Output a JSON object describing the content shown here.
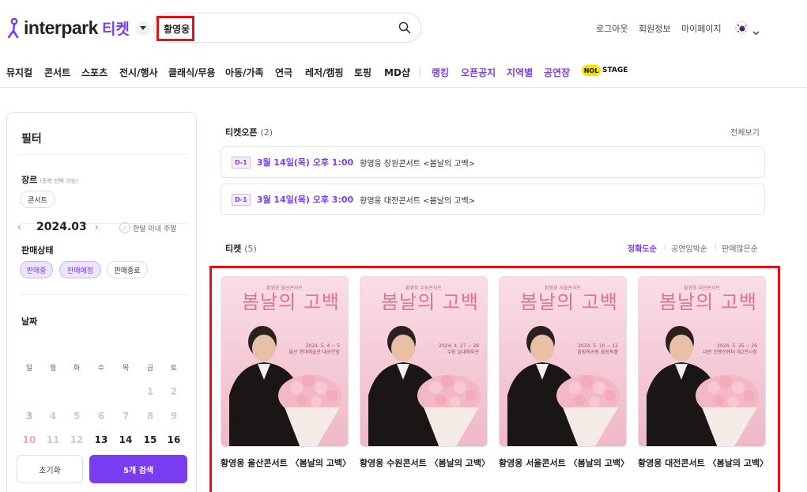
{
  "header": {
    "logo_text": "interpark",
    "logo_ticket": "티켓",
    "search_value": "황영웅",
    "util_links": [
      "로그아웃",
      "회원정보",
      "마이페이지"
    ]
  },
  "gnb": {
    "items": [
      "뮤지컬",
      "콘서트",
      "스포츠",
      "전시/행사",
      "클래식/무용",
      "아동/가족",
      "연극",
      "레저/캠핑",
      "토핑",
      "MD샵"
    ],
    "extra": [
      "랭킹",
      "오픈공지",
      "지역별",
      "공연장"
    ],
    "stage_badge": "NOL",
    "stage_text": "STAGE"
  },
  "filter": {
    "title": "필터",
    "genre_label": "장르",
    "genre_sub": "(중복 선택 가능)",
    "genre_chip": "콘서트",
    "status_label": "판매상태",
    "status_chips": [
      "판매중",
      "판매예정",
      "판매종료"
    ],
    "date_label": "날짜",
    "month": "2024.03",
    "weekend_toggle": "한달 이내 주말",
    "weekdays": [
      "일",
      "월",
      "화",
      "수",
      "목",
      "금",
      "토"
    ],
    "days_row1": [
      "1",
      "2"
    ],
    "days_row2": [
      "3",
      "4",
      "5",
      "6",
      "7",
      "8",
      "9"
    ],
    "days_row3": [
      "10",
      "11",
      "12",
      "13",
      "14",
      "15",
      "16"
    ],
    "reset_label": "초기화",
    "search_label": "5개 검색"
  },
  "ticket_open": {
    "title": "티켓오픈",
    "count": "(2)",
    "see_all": "전체보기",
    "items": [
      {
        "dday": "D-1",
        "date": "3월 14일(목) 오후 1:00",
        "name": "황영웅 창원콘서트 <봄날의 고백>"
      },
      {
        "dday": "D-1",
        "date": "3월 14일(목) 오후 3:00",
        "name": "황영웅 대전콘서트 <봄날의 고백>"
      }
    ]
  },
  "tickets": {
    "title": "티켓",
    "count": "(5)",
    "sort": [
      "정확도순",
      "공연임박순",
      "판매많은순"
    ],
    "items": [
      {
        "name": "황영웅 울산콘서트 〈봄날의 고백〉",
        "poster_sub": "황영웅 울산콘서트",
        "poster_title": "봄날의 고백",
        "poster_date": "2024. 5. 4 ~ 5",
        "poster_venue": "울산 현대예술관 대공연장"
      },
      {
        "name": "황영웅 수원콘서트 〈봄날의 고백〉",
        "poster_sub": "황영웅 수원콘서트",
        "poster_title": "봄날의 고백",
        "poster_date": "2024. 4. 27 ~ 28",
        "poster_venue": "수원 실내체육관"
      },
      {
        "name": "황영웅 서울콘서트 〈봄날의 고백〉",
        "poster_sub": "황영웅 서울콘서트",
        "poster_title": "봄날의 고백",
        "poster_date": "2024. 5. 10 ~ 12",
        "poster_venue": "올림픽공원 올림픽홀"
      },
      {
        "name": "황영웅 대전콘서트 〈봄날의 고백〉",
        "poster_sub": "황영웅 대전콘서트",
        "poster_title": "봄날의 고백",
        "poster_date": "2024. 5. 25 ~ 26",
        "poster_venue": "대전 컨벤션센터 제2전시장"
      }
    ]
  }
}
